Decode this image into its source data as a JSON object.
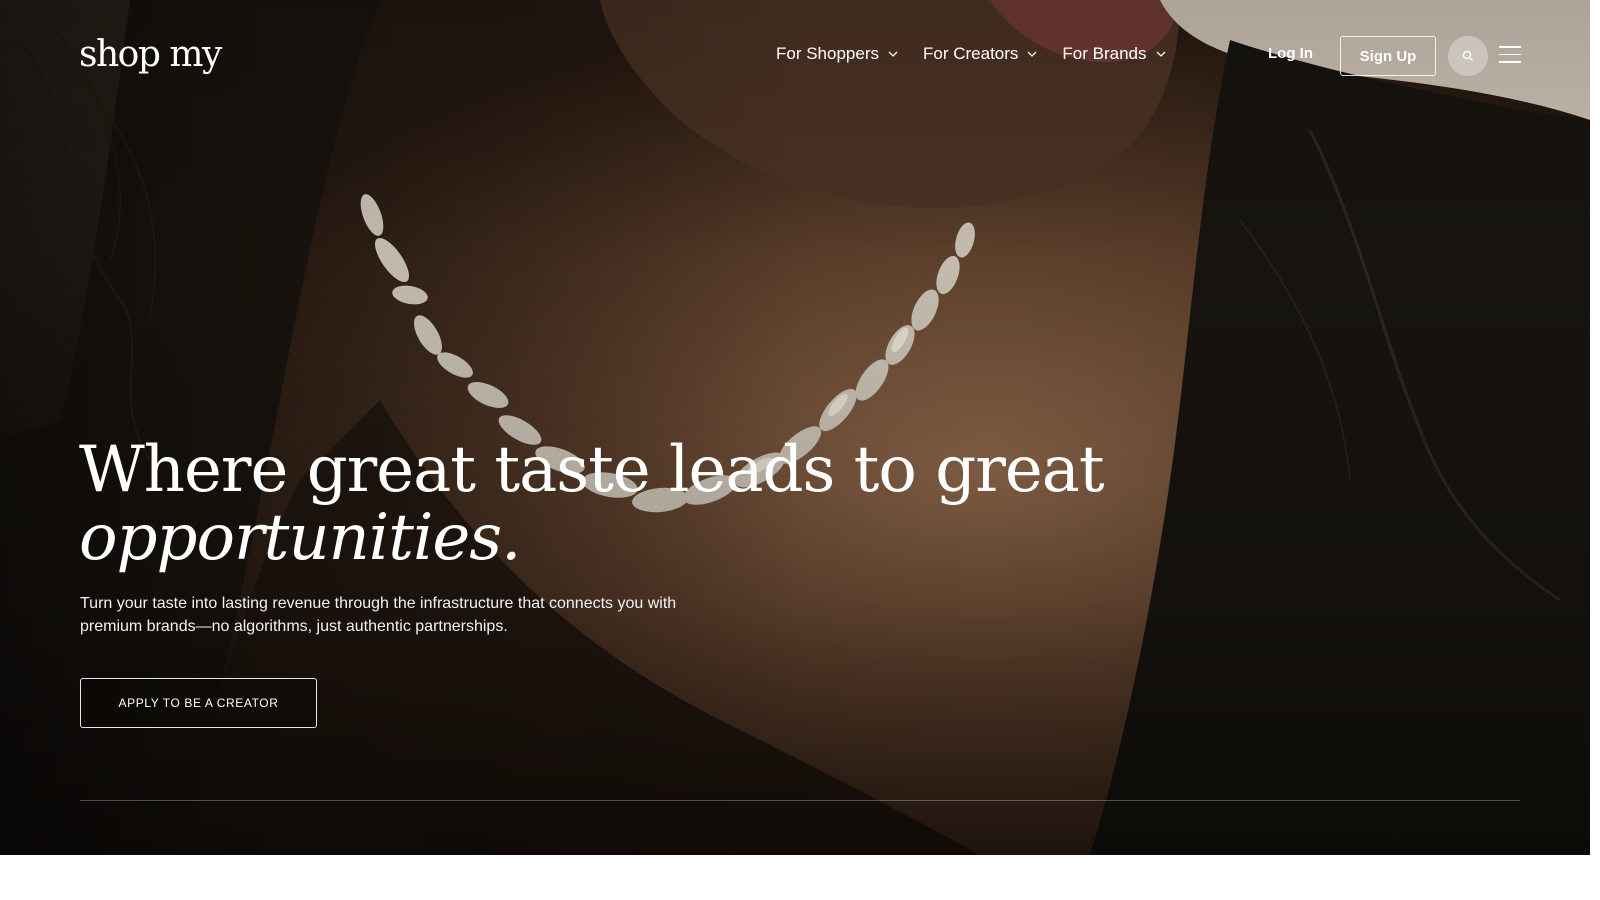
{
  "header": {
    "logo": "shop my",
    "nav": [
      {
        "label": "For Shoppers",
        "icon": "chevron-down-icon"
      },
      {
        "label": "For Creators",
        "icon": "chevron-down-icon"
      },
      {
        "label": "For Brands",
        "icon": "chevron-down-icon"
      }
    ],
    "login_label": "Log In",
    "signup_label": "Sign Up",
    "search_icon": "search-icon",
    "menu_icon": "hamburger-menu-icon"
  },
  "hero": {
    "headline_line1": "Where great taste leads to great",
    "headline_line2": "opportunities.",
    "subtext": "Turn your taste into lasting revenue through the infrastructure that connects you with premium brands—no algorithms, just authentic partnerships.",
    "cta_label": "APPLY TO BE A CREATOR"
  },
  "colors": {
    "text": "#ffffff",
    "background": "#ffffff",
    "hero_dark": "#1c140e"
  }
}
